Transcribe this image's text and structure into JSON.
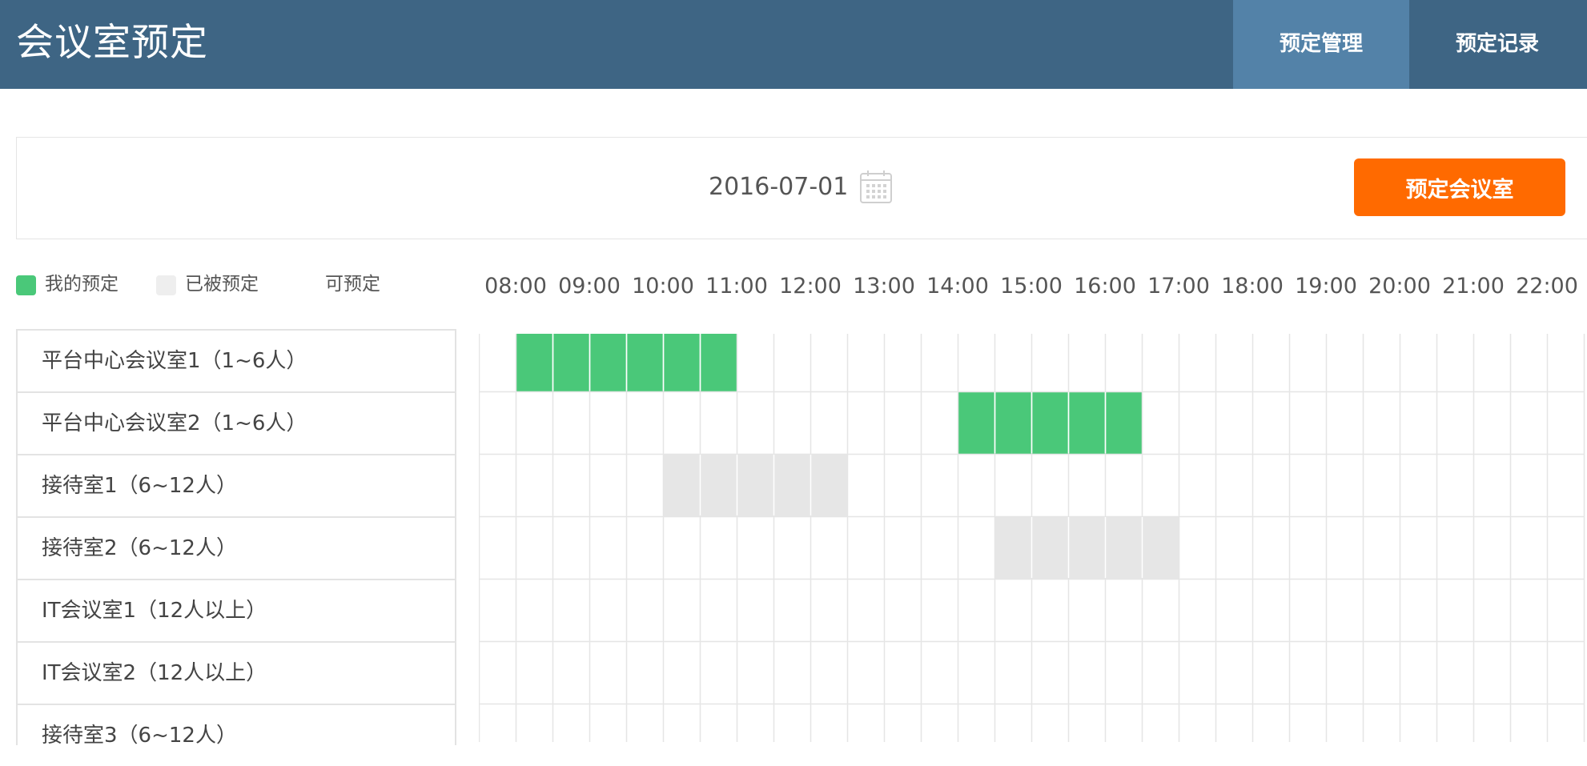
{
  "header": {
    "title": "会议室预定",
    "tabs": [
      {
        "label": "预定管理",
        "active": true
      },
      {
        "label": "预定记录",
        "active": false
      }
    ]
  },
  "toolbar": {
    "date": "2016-07-01",
    "calendar_icon": "calendar-icon",
    "book_button_label": "预定会议室"
  },
  "legend": {
    "mine": {
      "label": "我的预定",
      "color": "#4ac879"
    },
    "booked": {
      "label": "已被预定",
      "color": "#e6e6e6"
    },
    "available": {
      "label": "可预定",
      "color": "#ffffff"
    }
  },
  "schedule": {
    "hours": [
      "08:00",
      "09:00",
      "10:00",
      "11:00",
      "12:00",
      "13:00",
      "14:00",
      "15:00",
      "16:00",
      "17:00",
      "18:00",
      "19:00",
      "20:00",
      "21:00",
      "22:00"
    ],
    "first_slot_time": "07:30",
    "slot_minutes": 30,
    "slot_count": 30,
    "rooms": [
      {
        "name": "平台中心会议室1（1~6人）",
        "bookings": [
          {
            "status": "mine",
            "start": "08:00",
            "end": "11:00"
          }
        ]
      },
      {
        "name": "平台中心会议室2（1~6人）",
        "bookings": [
          {
            "status": "mine",
            "start": "14:00",
            "end": "16:30"
          }
        ]
      },
      {
        "name": "接待室1（6~12人）",
        "bookings": [
          {
            "status": "booked",
            "start": "10:00",
            "end": "12:30"
          }
        ]
      },
      {
        "name": "接待室2（6~12人）",
        "bookings": [
          {
            "status": "booked",
            "start": "14:30",
            "end": "17:00"
          }
        ]
      },
      {
        "name": "IT会议室1（12人以上）",
        "bookings": []
      },
      {
        "name": "IT会议室2（12人以上）",
        "bookings": []
      },
      {
        "name": "接待室3（6~12人）",
        "bookings": []
      }
    ]
  },
  "colors": {
    "header_bg": "#3e6584",
    "active_tab_bg": "#5382a8",
    "button_bg": "#ff6a00",
    "mine": "#4ac879",
    "booked": "#e6e6e6",
    "grid_line": "#e5e5e5"
  }
}
